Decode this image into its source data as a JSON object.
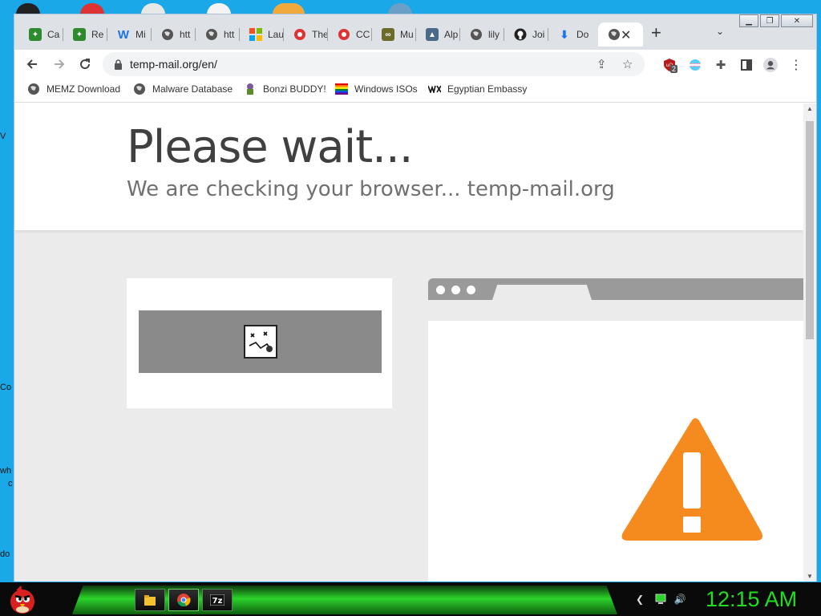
{
  "desktop": {
    "labels": [
      "V",
      "Co",
      "wh",
      "c",
      "do"
    ]
  },
  "browser": {
    "tabs": [
      {
        "label": "Ca",
        "icon": "bonzi-green-icon"
      },
      {
        "label": "Re",
        "icon": "bonzi-green-icon"
      },
      {
        "label": "Mi",
        "icon": "wikipedia-w-icon"
      },
      {
        "label": "htt",
        "icon": "globe-icon"
      },
      {
        "label": "htt",
        "icon": "globe-icon"
      },
      {
        "label": "Lau",
        "icon": "windows-logo-icon"
      },
      {
        "label": "The",
        "icon": "red-swirl-icon"
      },
      {
        "label": "CC",
        "icon": "red-swirl-icon"
      },
      {
        "label": "Mu",
        "icon": "sunglasses-icon"
      },
      {
        "label": "Alp",
        "icon": "landscape-icon"
      },
      {
        "label": "lily",
        "icon": "globe-icon"
      },
      {
        "label": "Joi",
        "icon": "github-icon"
      },
      {
        "label": "Do",
        "icon": "download-icon"
      }
    ],
    "active_tab_icon": "globe-icon",
    "url": "temp-mail.org/en/",
    "extension_badge": "2",
    "bookmarks": [
      {
        "label": "MEMZ Download",
        "icon": "globe-icon"
      },
      {
        "label": "Malware Database",
        "icon": "globe-icon"
      },
      {
        "label": "Bonzi BUDDY!",
        "icon": "bonzi-icon"
      },
      {
        "label": "Windows ISOs",
        "icon": "rainbow-flag-icon"
      },
      {
        "label": "Egyptian Embassy",
        "icon": "wix-icon"
      }
    ]
  },
  "page": {
    "title": "Please wait...",
    "subtitle": "We are checking your browser... temp-mail.org"
  },
  "taskbar": {
    "clock": "12:15 AM",
    "apps": [
      "file-explorer-icon",
      "chrome-icon",
      "7zip-icon"
    ]
  },
  "colors": {
    "warning": "#f58a1f",
    "clock": "#22dd22"
  }
}
